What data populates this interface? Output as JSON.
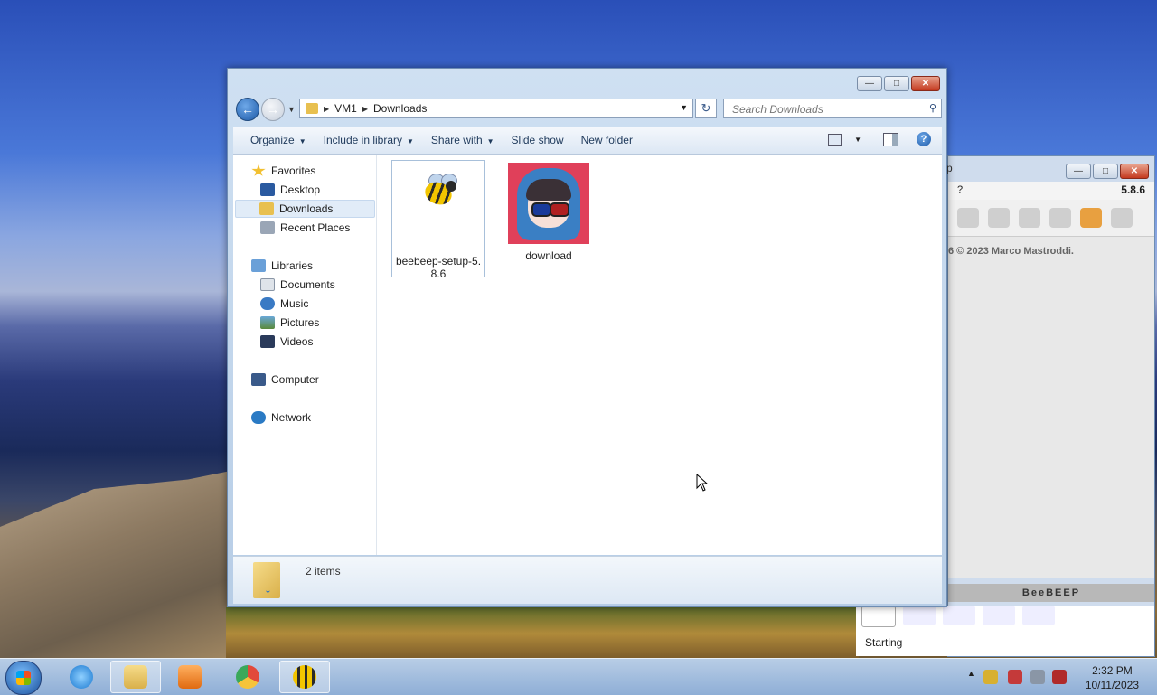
{
  "explorer": {
    "address": {
      "crumbs": [
        "VM1",
        "Downloads"
      ]
    },
    "search_placeholder": "Search Downloads",
    "toolbar": {
      "organize": "Organize",
      "include_in_library": "Include in library",
      "share_with": "Share with",
      "slide_show": "Slide show",
      "new_folder": "New folder"
    },
    "nav": {
      "favorites": "Favorites",
      "desktop": "Desktop",
      "downloads": "Downloads",
      "recent_places": "Recent Places",
      "libraries": "Libraries",
      "documents": "Documents",
      "music": "Music",
      "pictures": "Pictures",
      "videos": "Videos",
      "computer": "Computer",
      "network": "Network"
    },
    "files": [
      {
        "name": "beebeep-setup-5.8.6",
        "icon": "bee-installer-icon"
      },
      {
        "name": "download",
        "icon": "image-thumbnail"
      }
    ],
    "status": {
      "item_count": "2 items"
    }
  },
  "beebeep": {
    "menu_q": "?",
    "version": "5.8.6",
    "copyright": "6 © 2023 Marco Mastroddi.",
    "banner": "BeeBEEP",
    "status": "Starting"
  },
  "taskbar": {
    "time": "2:32 PM",
    "date": "10/11/2023"
  },
  "colors": {
    "accent": "#1e395b",
    "selection": "#e1ecf8",
    "close_button": "#c4391f"
  }
}
